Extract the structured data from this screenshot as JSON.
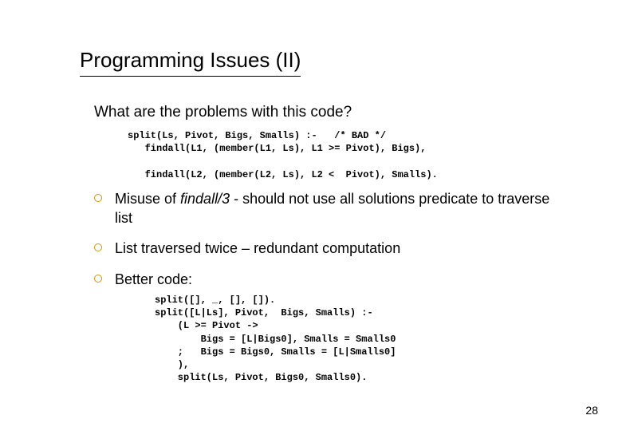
{
  "title": "Programming Issues (II)",
  "lead": "What are the problems with this code?",
  "code1": "split(Ls, Pivot, Bigs, Smalls) :-   /* BAD */\n   findall(L1, (member(L1, Ls), L1 >= Pivot), Bigs),\n\n   findall(L2, (member(L2, Ls), L2 <  Pivot), Smalls).",
  "bullet1_pre": "Misuse of ",
  "bullet1_it": "findall/3",
  "bullet1_post": " -  should not use all solutions predicate to traverse list",
  "bullet2": "List traversed twice – redundant computation",
  "bullet3": "Better code:",
  "code2": "split([], _, [], []).\nsplit([L|Ls], Pivot,  Bigs, Smalls) :-\n    (L >= Pivot ->\n        Bigs = [L|Bigs0], Smalls = Smalls0\n    ;   Bigs = Bigs0, Smalls = [L|Smalls0]\n    ),\n    split(Ls, Pivot, Bigs0, Smalls0).",
  "pagenum": "28"
}
